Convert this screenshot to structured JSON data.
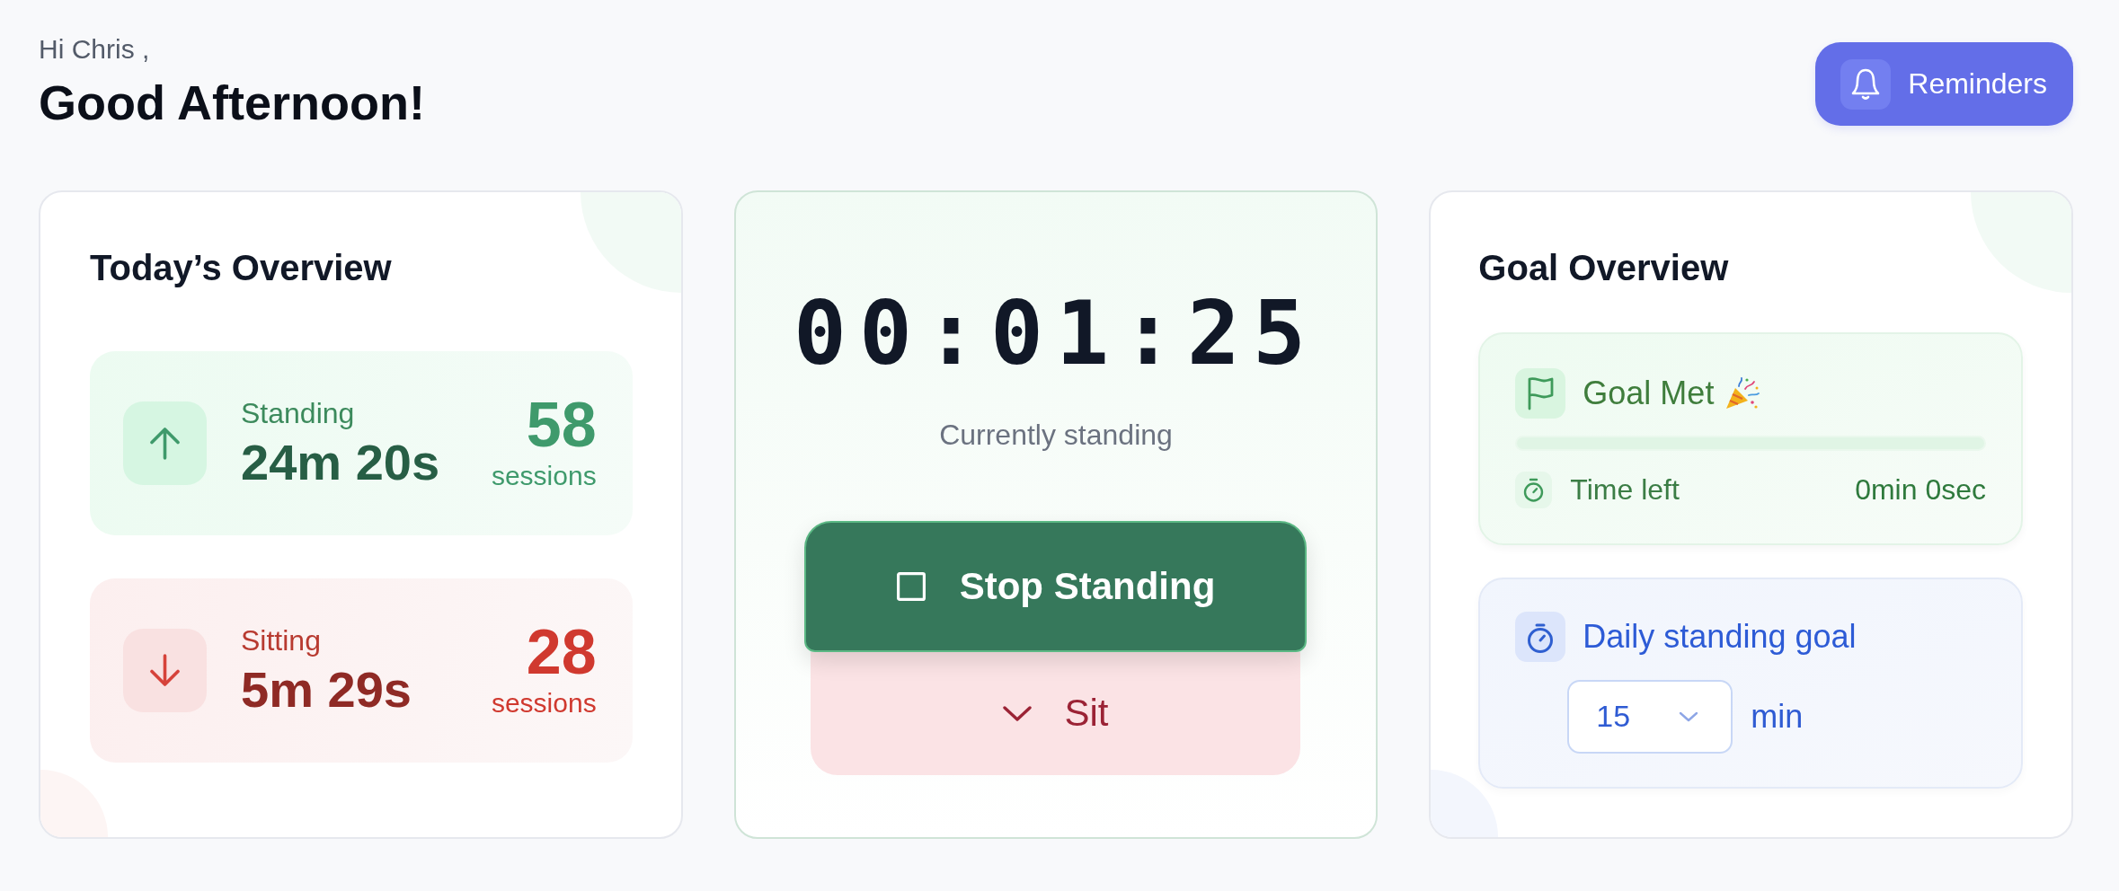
{
  "header": {
    "greeting": "Hi Chris ,",
    "title": "Good Afternoon!",
    "reminders_button": "Reminders"
  },
  "overview": {
    "title": "Today’s Overview",
    "stats": [
      {
        "kind": "standing",
        "label": "Standing",
        "duration": "24m 20s",
        "count": "58",
        "unit": "sessions"
      },
      {
        "kind": "sitting",
        "label": "Sitting",
        "duration": "5m 29s",
        "count": "28",
        "unit": "sessions"
      }
    ]
  },
  "timer": {
    "time": "00:01:25",
    "status": "Currently standing",
    "buttons": [
      {
        "kind": "stop",
        "label": "Stop Standing"
      },
      {
        "kind": "sit",
        "label": "Sit"
      }
    ]
  },
  "goal": {
    "title": "Goal Overview",
    "progress": {
      "label": "Goal Met",
      "level": 1,
      "time_left_label": "Time left",
      "time_left": "0min 0sec"
    },
    "daily_goal": {
      "label": "Daily standing goal",
      "value": "15",
      "unit": "min"
    }
  }
}
